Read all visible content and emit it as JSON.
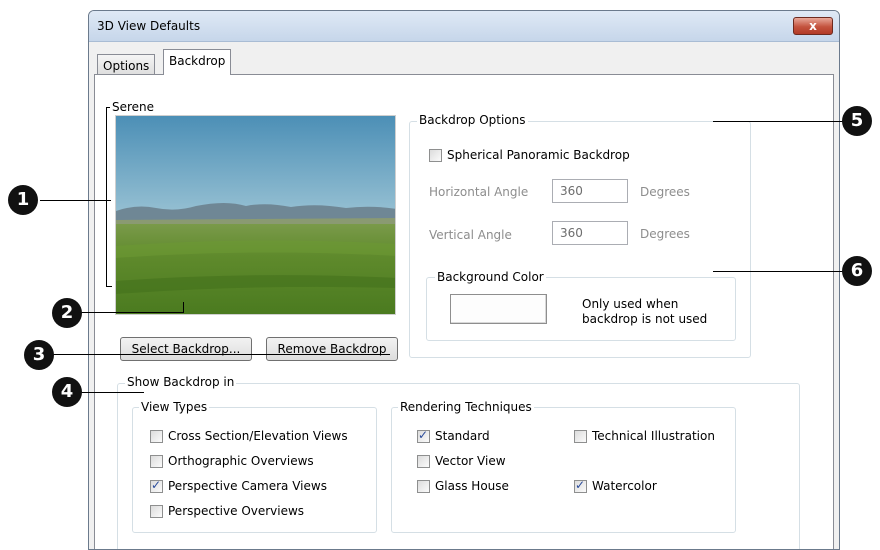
{
  "window": {
    "title": "3D View Defaults",
    "close_label": "x"
  },
  "tabs": [
    {
      "label": "Options"
    },
    {
      "label": "Backdrop"
    }
  ],
  "backdrop": {
    "name": "Serene",
    "select_label": "Select Backdrop...",
    "remove_label": "Remove Backdrop"
  },
  "backdrop_options": {
    "label": "Backdrop Options",
    "spherical_label": "Spherical Panoramic Backdrop",
    "spherical_checked": false,
    "horizontal_label": "Horizontal Angle",
    "horizontal_value": "360",
    "horizontal_unit": "Degrees",
    "vertical_label": "Vertical Angle",
    "vertical_value": "360",
    "vertical_unit": "Degrees"
  },
  "background_color": {
    "label": "Background Color",
    "note_line1": "Only used when",
    "note_line2": "backdrop is not used"
  },
  "show_backdrop": {
    "label": "Show Backdrop in",
    "view_types": {
      "label": "View Types",
      "items": [
        {
          "label": "Cross Section/Elevation Views",
          "checked": false
        },
        {
          "label": "Orthographic Overviews",
          "checked": false
        },
        {
          "label": "Perspective Camera Views",
          "checked": true
        },
        {
          "label": "Perspective Overviews",
          "checked": false
        }
      ]
    },
    "rendering": {
      "label": "Rendering Techniques",
      "items": [
        {
          "label": "Standard",
          "checked": true
        },
        {
          "label": "Vector View",
          "checked": false
        },
        {
          "label": "Glass House",
          "checked": false
        },
        {
          "label": "Technical Illustration",
          "checked": false
        },
        {
          "label": "Watercolor",
          "checked": true
        }
      ]
    }
  },
  "callouts": [
    "1",
    "2",
    "3",
    "4",
    "5",
    "6"
  ]
}
